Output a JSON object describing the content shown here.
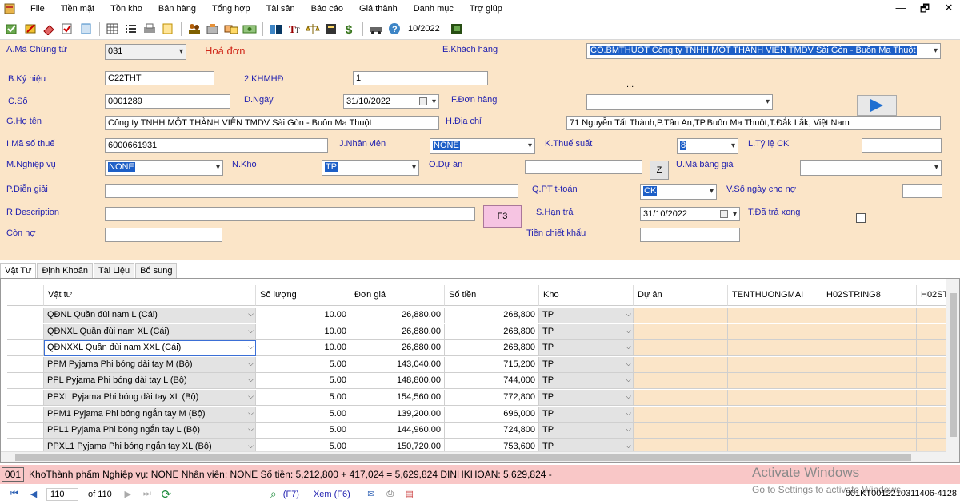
{
  "menu": [
    "File",
    "Tiền mặt",
    "Tồn kho",
    "Bán hàng",
    "Tổng hợp",
    "Tài sản",
    "Báo cáo",
    "Giá thành",
    "Danh mục",
    "Trợ giúp"
  ],
  "window_controls": [
    "—",
    "🗗",
    "✕"
  ],
  "toolbar": {
    "period": "10/2022"
  },
  "form": {
    "ma_chung_tu_label": "A.Mã Chứng từ",
    "ma_chung_tu_value": "031",
    "doc_type": "Hoá đơn",
    "khach_hang_label": "E.Khách hàng",
    "khach_hang_value": "CO.BMTHUOT Công ty TNHH MỘT THÀNH VIÊN TMDV Sài Gòn - Buôn Ma Thuột",
    "ky_hieu_label": "B.Ký hiệu",
    "ky_hieu_value": "C22THT",
    "khmhd_label": "2.KHMHĐ",
    "khmhd_value": "1",
    "ellipsis": "...",
    "so_label": "C.Số",
    "so_value": "0001289",
    "ngay_label": "D.Ngày",
    "ngay_value": "31/10/2022",
    "don_hang_label": "F.Đơn hàng",
    "don_hang_value": "",
    "ho_ten_label": "G.Họ tên",
    "ho_ten_value": "Công ty TNHH MỘT THÀNH VIÊN TMDV Sài Gòn - Buôn Ma Thuột",
    "dia_chi_label": "H.Địa chỉ",
    "dia_chi_value": "71 Nguyễn Tất Thành,P.Tân An,TP.Buôn Ma Thuột,T.Đắk Lắk, Việt Nam",
    "ma_so_thue_label": "I.Mã số thuế",
    "ma_so_thue_value": "6000661931",
    "nhan_vien_label": "J.Nhân viên",
    "nhan_vien_value": "NONE",
    "thue_suat_label": "K.Thuế suất",
    "thue_suat_value": "8",
    "ty_le_ck_label": "L.Tỷ lệ CK",
    "ty_le_ck_value": "",
    "nghiep_vu_label": "M.Nghiệp vụ",
    "nghiep_vu_value": "NONE",
    "kho_label": "N.Kho",
    "kho_value": "TP",
    "du_an_label": "O.Dự án",
    "du_an_value": "",
    "z_button": "Z",
    "ma_bang_gia_label": "U.Mã bảng giá",
    "ma_bang_gia_value": "",
    "dien_giai_label": "P.Diễn giải",
    "dien_giai_value": "",
    "pt_ttoan_label": "Q.PT t-toán",
    "pt_ttoan_value": "CK",
    "so_ngay_no_label": "V.Số ngày cho nợ",
    "so_ngay_no_value": "",
    "description_label": "R.Description",
    "description_value": "",
    "f3_button": "F3",
    "han_tra_label": "S.Hạn trả",
    "han_tra_value": "31/10/2022",
    "da_tra_xong_label": "T.Đã trả xong",
    "con_no_label": "Còn nợ",
    "con_no_value": "",
    "tien_chiet_khau_label": "Tiền chiết khấu",
    "tien_chiet_khau_value": ""
  },
  "tabs": [
    "Vật Tư",
    "Định Khoản",
    "Tài Liệu",
    "Bổ sung"
  ],
  "grid": {
    "headers": [
      "Vật tư",
      "Số lượng",
      "Đơn giá",
      "Số tiền",
      "Kho",
      "Dự án",
      "TENTHUONGMAI",
      "H02STRING8",
      "H02ST"
    ],
    "rows": [
      {
        "vat_tu": "QĐNL Quần đùi nam L (Cái)",
        "so_luong": "10.00",
        "don_gia": "26,880.00",
        "so_tien": "268,800",
        "kho": "TP"
      },
      {
        "vat_tu": "QĐNXL Quần đùi nam XL (Cái)",
        "so_luong": "10.00",
        "don_gia": "26,880.00",
        "so_tien": "268,800",
        "kho": "TP"
      },
      {
        "vat_tu": "QĐNXXL Quần đùi nam XXL (Cái)",
        "so_luong": "10.00",
        "don_gia": "26,880.00",
        "so_tien": "268,800",
        "kho": "TP"
      },
      {
        "vat_tu": "PPM Pyjama  Phi bóng dài tay M (Bộ)",
        "so_luong": "5.00",
        "don_gia": "143,040.00",
        "so_tien": "715,200",
        "kho": "TP"
      },
      {
        "vat_tu": "PPL Pyjama  Phi bóng dài tay L (Bộ)",
        "so_luong": "5.00",
        "don_gia": "148,800.00",
        "so_tien": "744,000",
        "kho": "TP"
      },
      {
        "vat_tu": "PPXL Pyjama  Phi bóng dài tay XL (Bộ)",
        "so_luong": "5.00",
        "don_gia": "154,560.00",
        "so_tien": "772,800",
        "kho": "TP"
      },
      {
        "vat_tu": "PPM1 Pyjama  Phi bóng ngắn tay  M (Bộ)",
        "so_luong": "5.00",
        "don_gia": "139,200.00",
        "so_tien": "696,000",
        "kho": "TP"
      },
      {
        "vat_tu": "PPL1 Pyjama  Phi bóng ngắn tay  L (Bộ)",
        "so_luong": "5.00",
        "don_gia": "144,960.00",
        "so_tien": "724,800",
        "kho": "TP"
      },
      {
        "vat_tu": "PPXL1 Pyjama  Phi bóng ngắn tay  XL (Bộ)",
        "so_luong": "5.00",
        "don_gia": "150,720.00",
        "so_tien": "753,600",
        "kho": "TP"
      }
    ]
  },
  "status": {
    "record": "001",
    "text": "KhoThành phẩm  Nghiệp vụ: NONE  Nhân viên: NONE  Số tiền: 5,212,800 + 417,024 = 5,629,824  DINHKHOAN: 5,629,824  -"
  },
  "watermark": {
    "line1": "Activate Windows",
    "line2": "Go to Settings to activate Windows."
  },
  "nav": {
    "position": "110",
    "of_total": "of 110",
    "find": "(F7)",
    "view": "Xem (F6)",
    "doc_code": "001KT0012210311406-4128"
  },
  "colors": {
    "form_bg": "#fbe5c8",
    "label_blue": "#1f1fb0",
    "status_pink": "#f9c7c7",
    "selection_blue": "#1d5fc7",
    "doc_type_red": "#d0281a"
  }
}
